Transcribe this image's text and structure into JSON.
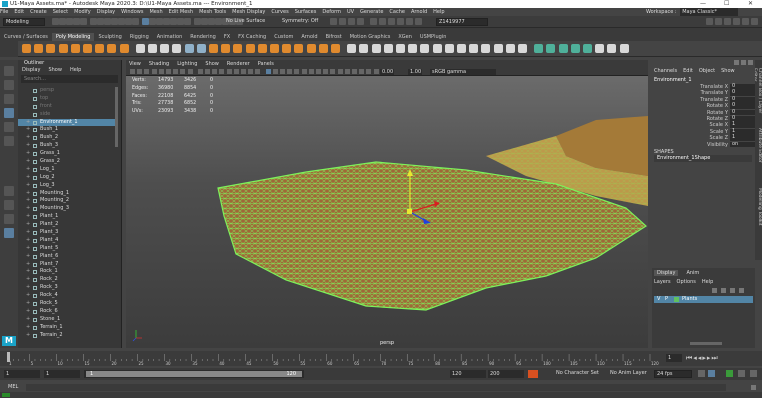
{
  "window": {
    "title": "U1-Maya Assets.ma* - Autodesk Maya 2020.3: D:\\U1-Maya Assets.ma --- Environment_1"
  },
  "menubar": [
    "File",
    "Edit",
    "Create",
    "Select",
    "Modify",
    "Display",
    "Windows",
    "Mesh",
    "Edit Mesh",
    "Mesh Tools",
    "Mesh Display",
    "Curves",
    "Surfaces",
    "Deform",
    "UV",
    "Generate",
    "Cache",
    "Arnold",
    "Help"
  ],
  "workspace": {
    "label": "Workspace :",
    "value": "Maya Classic*"
  },
  "statusline": {
    "mode": "Modeling",
    "live_surface": "No Live Surface",
    "symmetry": "Symmetry: Off",
    "object_name": "Z1419977"
  },
  "shelf_tabs": [
    "Curves / Surfaces",
    "Poly Modeling",
    "Sculpting",
    "Rigging",
    "Animation",
    "Rendering",
    "FX",
    "FX Caching",
    "Custom",
    "Arnold",
    "Bifrost",
    "Motion Graphics",
    "XGen",
    "USMPlugin"
  ],
  "shelf_active": "Poly Modeling",
  "outliner": {
    "title": "Outliner",
    "menu": [
      "Display",
      "Show",
      "Help"
    ],
    "search_placeholder": "Search...",
    "items": [
      "persp",
      "top",
      "front",
      "side",
      "Environment_1",
      "Bush_1",
      "Bush_2",
      "Bush_3",
      "Grass_1",
      "Grass_2",
      "Log_1",
      "Log_2",
      "Log_3",
      "Mounting_1",
      "Mounting_2",
      "Mounting_3",
      "Plant_1",
      "Plant_2",
      "Plant_3",
      "Plant_4",
      "Plant_5",
      "Plant_6",
      "Plant_7",
      "Rock_1",
      "Rock_2",
      "Rock_3",
      "Rock_4",
      "Rock_5",
      "Rock_6",
      "Stone_1",
      "Terrain_1",
      "Terrain_2"
    ],
    "selected": "Environment_1"
  },
  "viewport": {
    "menu": [
      "View",
      "Shading",
      "Lighting",
      "Show",
      "Renderer",
      "Panels"
    ],
    "value_a": "0.00",
    "value_b": "1.00",
    "color_space": "sRGB gamma",
    "hud": [
      {
        "label": "Verts:",
        "a": "14793",
        "b": "3426",
        "c": "0"
      },
      {
        "label": "Edges:",
        "a": "36980",
        "b": "8854",
        "c": "0"
      },
      {
        "label": "Faces:",
        "a": "22108",
        "b": "6425",
        "c": "0"
      },
      {
        "label": "Tris:",
        "a": "27738",
        "b": "6852",
        "c": "0"
      },
      {
        "label": "UVs:",
        "a": "23093",
        "b": "3438",
        "c": "0"
      }
    ],
    "camera_label": "persp"
  },
  "channelbox": {
    "menu": [
      "Channels",
      "Edit",
      "Object",
      "Show"
    ],
    "object": "Environment_1",
    "channels": [
      {
        "name": "Translate X",
        "value": "0"
      },
      {
        "name": "Translate Y",
        "value": "0"
      },
      {
        "name": "Translate Z",
        "value": "0"
      },
      {
        "name": "Rotate X",
        "value": "0"
      },
      {
        "name": "Rotate Y",
        "value": "0"
      },
      {
        "name": "Rotate Z",
        "value": "0"
      },
      {
        "name": "Scale X",
        "value": "1"
      },
      {
        "name": "Scale Y",
        "value": "1"
      },
      {
        "name": "Scale Z",
        "value": "1"
      },
      {
        "name": "Visibility",
        "value": "on"
      }
    ],
    "shapes_label": "SHAPES",
    "shape_name": "Environment_1Shape"
  },
  "layers": {
    "tabs": [
      "Display",
      "Anim"
    ],
    "menu": [
      "Layers",
      "Options",
      "Help"
    ],
    "layer_name": "Plants",
    "layer_v": "V",
    "layer_p": "P"
  },
  "side_tabs": [
    "Channel Box / Layer Editor",
    "Attribute Editor",
    "Modelling Toolkit"
  ],
  "timeline": {
    "ticks": [
      "1",
      "5",
      "10",
      "15",
      "20",
      "25",
      "30",
      "35",
      "40",
      "45",
      "50",
      "55",
      "60",
      "65",
      "70",
      "75",
      "80",
      "85",
      "90",
      "95",
      "100",
      "105",
      "110",
      "115",
      "120"
    ],
    "current": "1"
  },
  "range": {
    "start": "1",
    "start2": "1",
    "slider_start": "1",
    "slider_end": "120",
    "end": "120",
    "end2": "200",
    "char_set": "No Character Set",
    "anim_layer": "No Anim Layer",
    "fps": "24 fps"
  },
  "cmdline": {
    "label": "MEL"
  }
}
